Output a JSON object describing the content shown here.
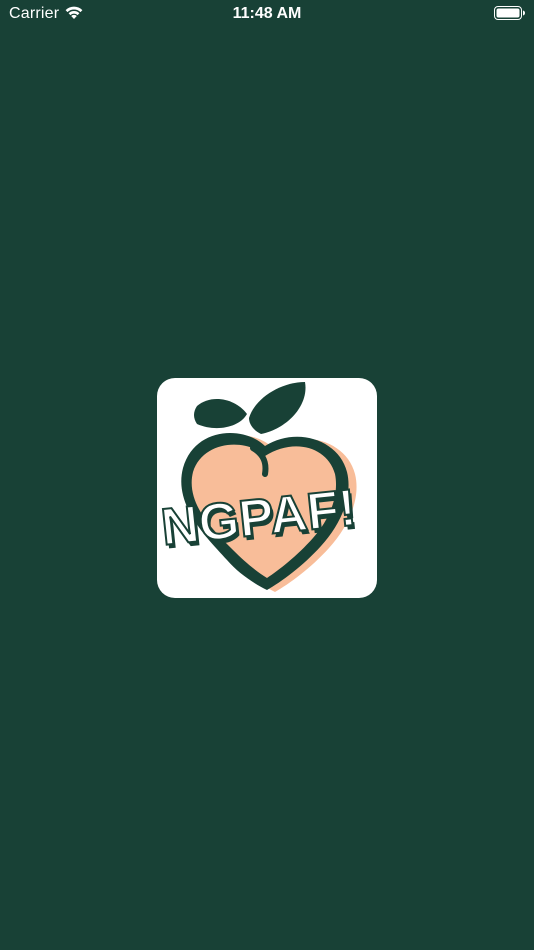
{
  "status_bar": {
    "carrier": "Carrier",
    "time": "11:48 AM",
    "icons": [
      "wifi-icon",
      "battery-icon"
    ]
  },
  "splash": {
    "logo_text": "NGPAF!",
    "logo_icon": "peach-heart-logo",
    "colors": {
      "background": "#184136",
      "logo_tile": "#ffffff",
      "peach": "#f8bd99",
      "leaf": "#184136"
    }
  }
}
